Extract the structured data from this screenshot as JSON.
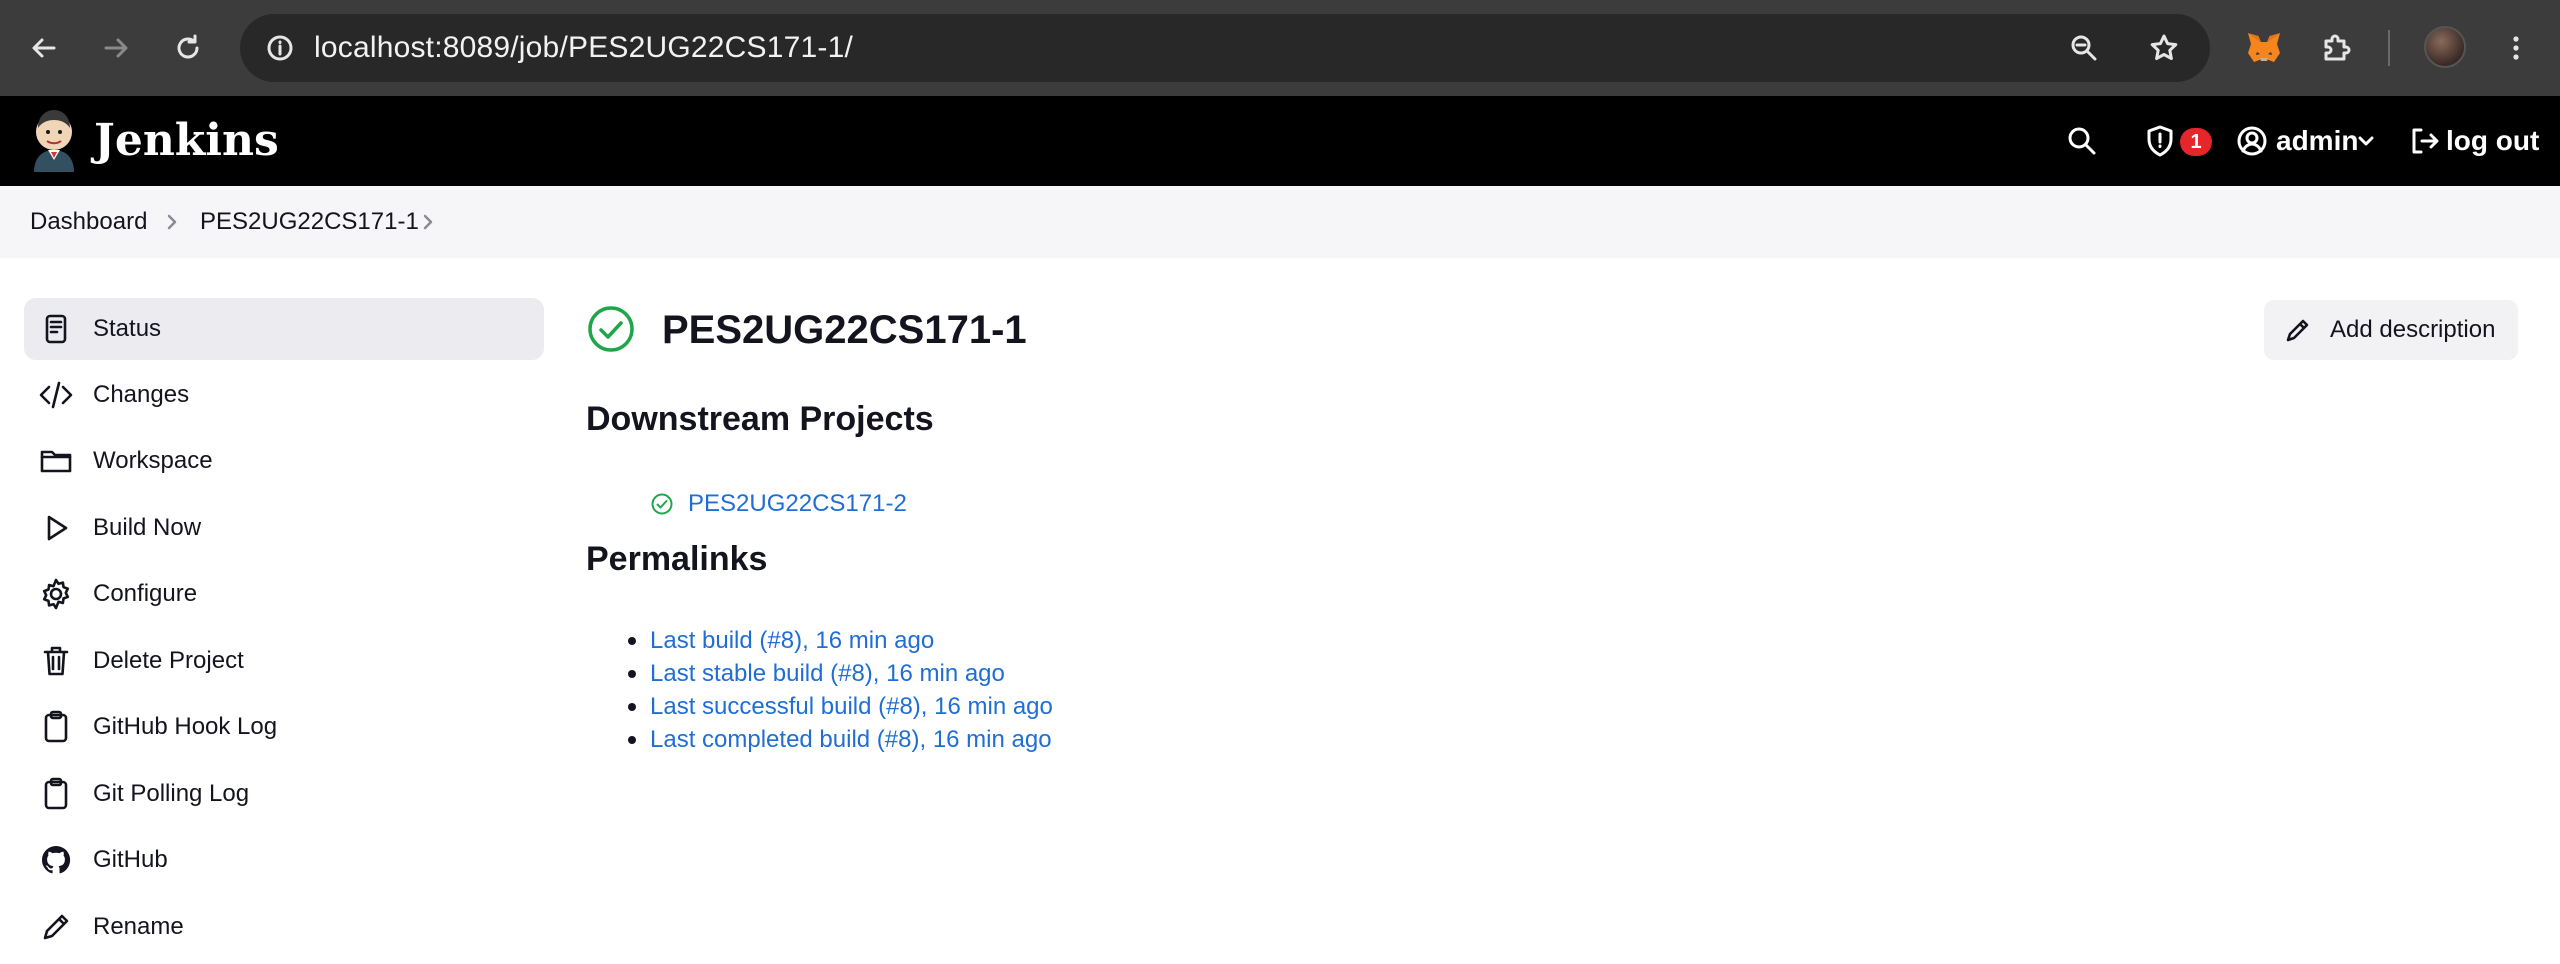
{
  "browser": {
    "url": "localhost:8089/job/PES2UG22CS171-1/"
  },
  "header": {
    "app_title": "Jenkins",
    "security_badge_count": "1",
    "user": "admin",
    "logout_label": "log out"
  },
  "breadcrumbs": [
    "Dashboard",
    "PES2UG22CS171-1"
  ],
  "sidebar": {
    "items": [
      {
        "label": "Status",
        "icon": "status-icon",
        "active": true
      },
      {
        "label": "Changes",
        "icon": "code-icon"
      },
      {
        "label": "Workspace",
        "icon": "folder-icon"
      },
      {
        "label": "Build Now",
        "icon": "play-icon"
      },
      {
        "label": "Configure",
        "icon": "gear-icon"
      },
      {
        "label": "Delete Project",
        "icon": "trash-icon"
      },
      {
        "label": "GitHub Hook Log",
        "icon": "clipboard-icon"
      },
      {
        "label": "Git Polling Log",
        "icon": "clipboard-icon"
      },
      {
        "label": "GitHub",
        "icon": "github-icon"
      },
      {
        "label": "Rename",
        "icon": "pencil-icon"
      }
    ]
  },
  "main": {
    "title": "PES2UG22CS171-1",
    "add_description_label": "Add description",
    "downstream_heading": "Downstream Projects",
    "downstream": [
      {
        "name": "PES2UG22CS171-2",
        "status": "success"
      }
    ],
    "permalinks_heading": "Permalinks",
    "permalinks": [
      "Last build (#8), 16 min ago",
      "Last stable build (#8), 16 min ago",
      "Last successful build (#8), 16 min ago",
      "Last completed build (#8), 16 min ago"
    ]
  },
  "colors": {
    "link": "#1f6ed6",
    "success": "#1ea64a",
    "badge": "#e5262b",
    "header_bg": "#000000"
  }
}
